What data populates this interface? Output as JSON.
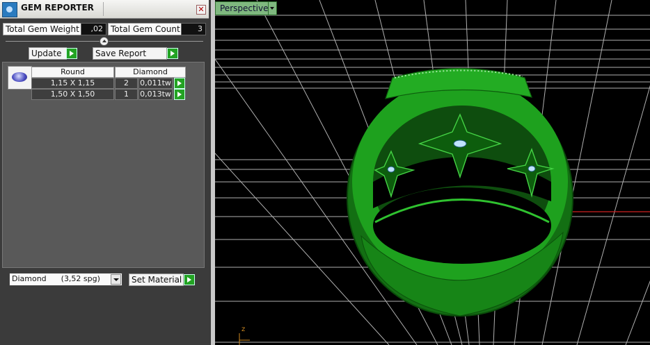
{
  "panel": {
    "title": "GEM REPORTER",
    "close_symbol": "✕",
    "total_weight_label": "Total Gem Weight",
    "total_weight_value": ",02",
    "total_count_label": "Total Gem Count",
    "total_count_value": "3",
    "update_label": "Update",
    "save_report_label": "Save Report",
    "table": {
      "headers": [
        "Round",
        "Diamond"
      ],
      "rows": [
        {
          "size": "1,15 X 1,15",
          "count": "2",
          "weight": "0,011tw"
        },
        {
          "size": "1,50 X 1,50",
          "count": "1",
          "weight": "0,013tw"
        }
      ]
    },
    "material_select": "Diamond      (3,52 spg)",
    "set_material_label": "Set Material"
  },
  "viewport": {
    "view_label": "Perspective",
    "axis_label": "z",
    "ring_color": "#1a8f1a",
    "grid_color": "#cfcfcf"
  }
}
